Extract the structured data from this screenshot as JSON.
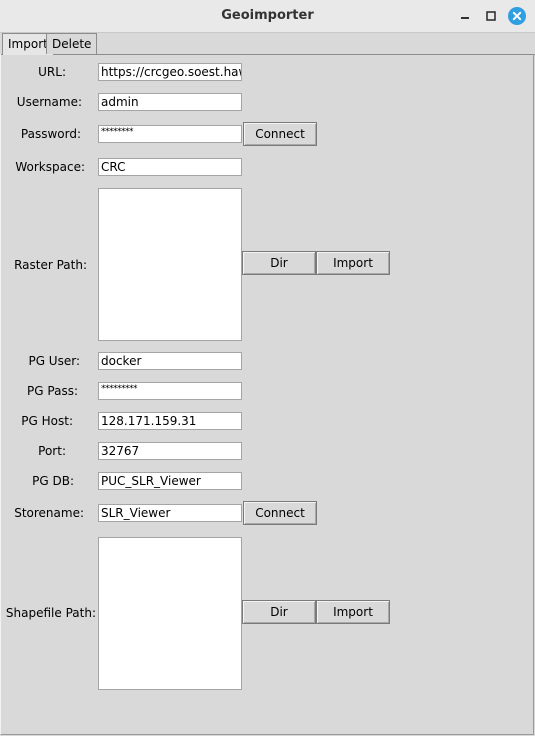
{
  "window": {
    "title": "Geoimporter"
  },
  "tabs": [
    {
      "label": "Import",
      "active": true
    },
    {
      "label": "Delete",
      "active": false
    }
  ],
  "geoserver": {
    "url_label": "URL:",
    "url_value": "https://crcgeo.soest.hawaii.edu/geoserver",
    "username_label": "Username:",
    "username_value": "admin",
    "password_label": "Password:",
    "password_value": "********",
    "connect_label": "Connect",
    "workspace_label": "Workspace:",
    "workspace_value": "CRC",
    "raster_path_label": "Raster Path:",
    "raster_dir_label": "Dir",
    "raster_import_label": "Import"
  },
  "postgis": {
    "pg_user_label": "PG User:",
    "pg_user_value": "docker",
    "pg_pass_label": "PG Pass:",
    "pg_pass_value": "*********",
    "pg_host_label": "PG Host:",
    "pg_host_value": "128.171.159.31",
    "port_label": "Port:",
    "port_value": "32767",
    "pg_db_label": "PG DB:",
    "pg_db_value": "PUC_SLR_Viewer",
    "storename_label": "Storename:",
    "storename_value": "SLR_Viewer",
    "connect_label": "Connect",
    "shapefile_path_label": "Shapefile Path:",
    "shapefile_dir_label": "Dir",
    "shapefile_import_label": "Import"
  },
  "icons": {
    "minimize": "minimize-icon",
    "maximize": "maximize-icon",
    "close": "close-icon"
  },
  "colors": {
    "close_button": "#2f9fe2",
    "background": "#d9d9d9"
  }
}
